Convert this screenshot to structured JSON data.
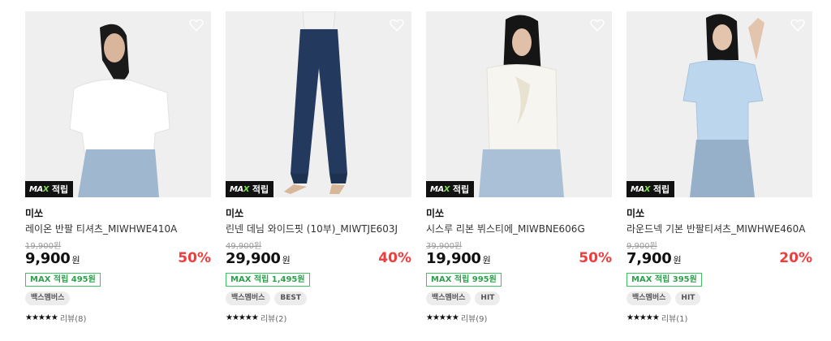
{
  "products": [
    {
      "badge": "적립",
      "brand": "미쏘",
      "name": "레이온 반팔 티셔츠_MIWHWE410A",
      "original_price": "19,900원",
      "price": "9,900",
      "currency": "원",
      "discount": "50%",
      "points": "MAX 적립 495원",
      "tags": [
        "백스멤버스"
      ],
      "stars": "★★★★★",
      "review": "리뷰(8)"
    },
    {
      "badge": "적립",
      "brand": "미쏘",
      "name": "린넨 데님 와이드핏 (10부)_MIWTJE603J",
      "original_price": "49,900원",
      "price": "29,900",
      "currency": "원",
      "discount": "40%",
      "points": "MAX 적립 1,495원",
      "tags": [
        "백스멤버스",
        "BEST"
      ],
      "stars": "★★★★★",
      "review": "리뷰(2)"
    },
    {
      "badge": "적립",
      "brand": "미쏘",
      "name": "시스루 리본 뷔스티에_MIWBNE606G",
      "original_price": "39,900원",
      "price": "19,900",
      "currency": "원",
      "discount": "50%",
      "points": "MAX 적립 995원",
      "tags": [
        "백스멤버스",
        "HIT"
      ],
      "stars": "★★★★★",
      "review": "리뷰(9)"
    },
    {
      "badge": "적립",
      "brand": "미쏘",
      "name": "라운드넥 기본 반팔티셔츠_MIWHWE460A",
      "original_price": "9,900원",
      "price": "7,900",
      "currency": "원",
      "discount": "20%",
      "points": "MAX 적립 395원",
      "tags": [
        "백스멤버스",
        "HIT"
      ],
      "stars": "★★★★★",
      "review": "리뷰(1)"
    }
  ],
  "colors": {
    "discount": "#f03c3c",
    "points_border": "#3ec264",
    "badge_bg": "#111111",
    "image_bg": "#f0f0f0"
  },
  "icons": {
    "wishlist": "heart-outline-icon",
    "badge_logo": "max-logo-icon",
    "rating": "star-icon"
  }
}
